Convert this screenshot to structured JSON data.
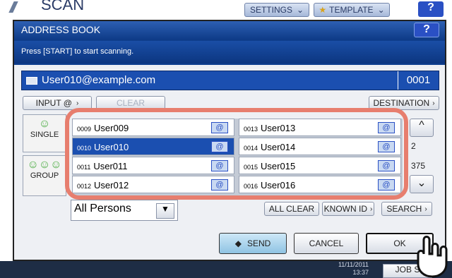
{
  "app": {
    "title": "SCAN",
    "settings_label": "SETTINGS",
    "template_label": "TEMPLATE",
    "help": "?"
  },
  "dialog": {
    "title": "ADDRESS BOOK",
    "help": "?",
    "message": "Press [START] to start scanning."
  },
  "address_bar": {
    "email": "User010@example.com",
    "count": "0001"
  },
  "toolbar": {
    "input_label": "INPUT @",
    "clear_label": "CLEAR",
    "destination_label": "DESTINATION"
  },
  "tabs": {
    "single": "SINGLE",
    "group": "GROUP"
  },
  "entries": [
    {
      "num": "0009",
      "name": "User009",
      "selected": false
    },
    {
      "num": "0013",
      "name": "User013",
      "selected": false
    },
    {
      "num": "0010",
      "name": "User010",
      "selected": true
    },
    {
      "num": "0014",
      "name": "User014",
      "selected": false
    },
    {
      "num": "0011",
      "name": "User011",
      "selected": false
    },
    {
      "num": "0015",
      "name": "User015",
      "selected": false
    },
    {
      "num": "0012",
      "name": "User012",
      "selected": false
    },
    {
      "num": "0016",
      "name": "User016",
      "selected": false
    }
  ],
  "pagination": {
    "current": "2",
    "total": "375"
  },
  "filter": {
    "selected": "All Persons"
  },
  "actions": {
    "all_clear": "ALL CLEAR",
    "known_id": "KNOWN ID",
    "search": "SEARCH"
  },
  "footer": {
    "send": "SEND",
    "cancel": "CANCEL",
    "ok": "OK"
  },
  "status": {
    "date": "11/11/2011",
    "time": "13:37",
    "job_status": "JOB S"
  }
}
